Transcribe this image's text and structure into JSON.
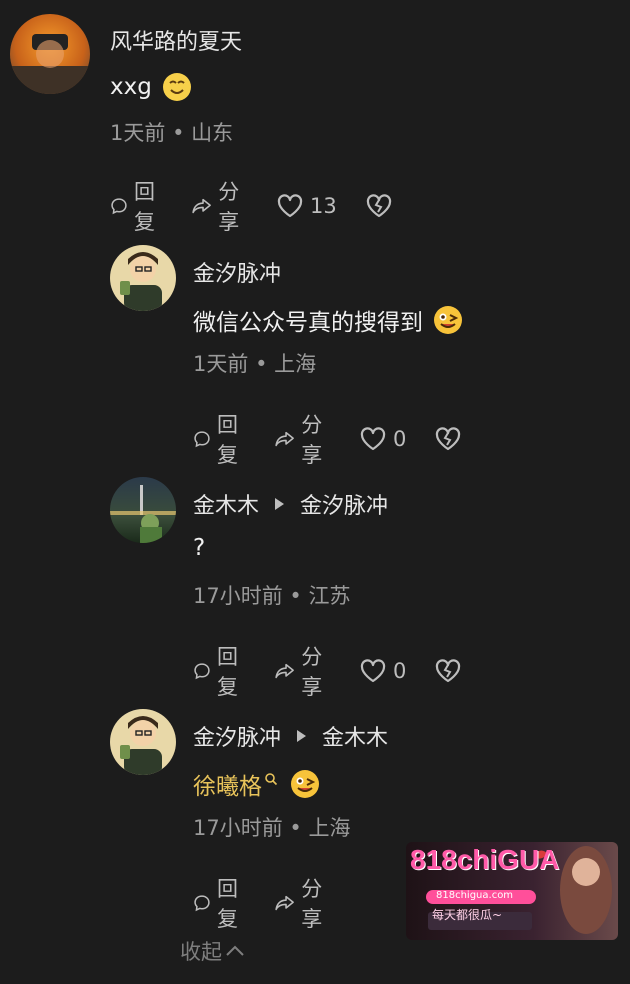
{
  "comments": [
    {
      "name": "风华路的夏天",
      "text": "xxg",
      "emoji": "grin-emoji",
      "time": "1天前",
      "location": "山东",
      "reply": "回复",
      "share": "分享",
      "likes": "13"
    },
    {
      "name": "金汐脉冲",
      "text": "微信公众号真的搜得到",
      "emoji": "yum-emoji",
      "time": "1天前",
      "location": "上海",
      "reply": "回复",
      "share": "分享",
      "likes": "0"
    },
    {
      "name": "金木木",
      "reply_to": "金汐脉冲",
      "text": "?",
      "time": "17小时前",
      "location": "江苏",
      "reply": "回复",
      "share": "分享",
      "likes": "0"
    },
    {
      "name": "金汐脉冲",
      "reply_to": "金木木",
      "text_link": "徐曦格",
      "emoji": "yum-emoji",
      "time": "17小时前",
      "location": "上海",
      "reply": "回复",
      "share": "分享"
    }
  ],
  "separator": "•",
  "collapse_label": "收起",
  "ad": {
    "brand": "818chiGUA",
    "domain": "818chigua.com",
    "slogan": "每天都很瓜~",
    "colors": {
      "pink": "#ff4f9a",
      "bg": "#2a1a22"
    }
  },
  "colors": {
    "background": "#1c1c1c",
    "link": "#e8c35a",
    "meta": "#9a9a9a"
  }
}
